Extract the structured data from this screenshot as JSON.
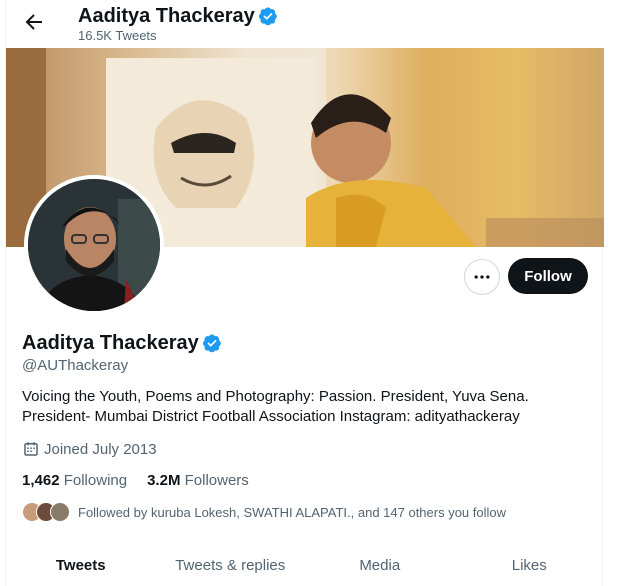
{
  "header": {
    "name": "Aaditya Thackeray",
    "tweet_count": "16.5K Tweets"
  },
  "profile": {
    "name": "Aaditya Thackeray",
    "handle": "@AUThackeray",
    "bio": "Voicing the Youth, Poems and Photography: Passion. President, Yuva Sena. President- Mumbai District Football Association Instagram: adityathackeray",
    "joined": "Joined July 2013",
    "following_count": "1,462",
    "following_label": "Following",
    "followers_count": "3.2M",
    "followers_label": "Followers",
    "followed_by": "Followed by kuruba Lokesh, SWATHI ALAPATI., and 147 others you follow"
  },
  "actions": {
    "follow_label": "Follow"
  },
  "tabs": [
    {
      "label": "Tweets",
      "active": true
    },
    {
      "label": "Tweets & replies",
      "active": false
    },
    {
      "label": "Media",
      "active": false
    },
    {
      "label": "Likes",
      "active": false
    }
  ],
  "icons": {
    "back": "back-arrow-icon",
    "verified": "verified-badge-icon",
    "more": "more-horizontal-icon",
    "calendar": "calendar-icon"
  },
  "colors": {
    "verified": "#1d9bf0",
    "follow_bg": "#0f1419",
    "secondary_text": "#536471"
  }
}
